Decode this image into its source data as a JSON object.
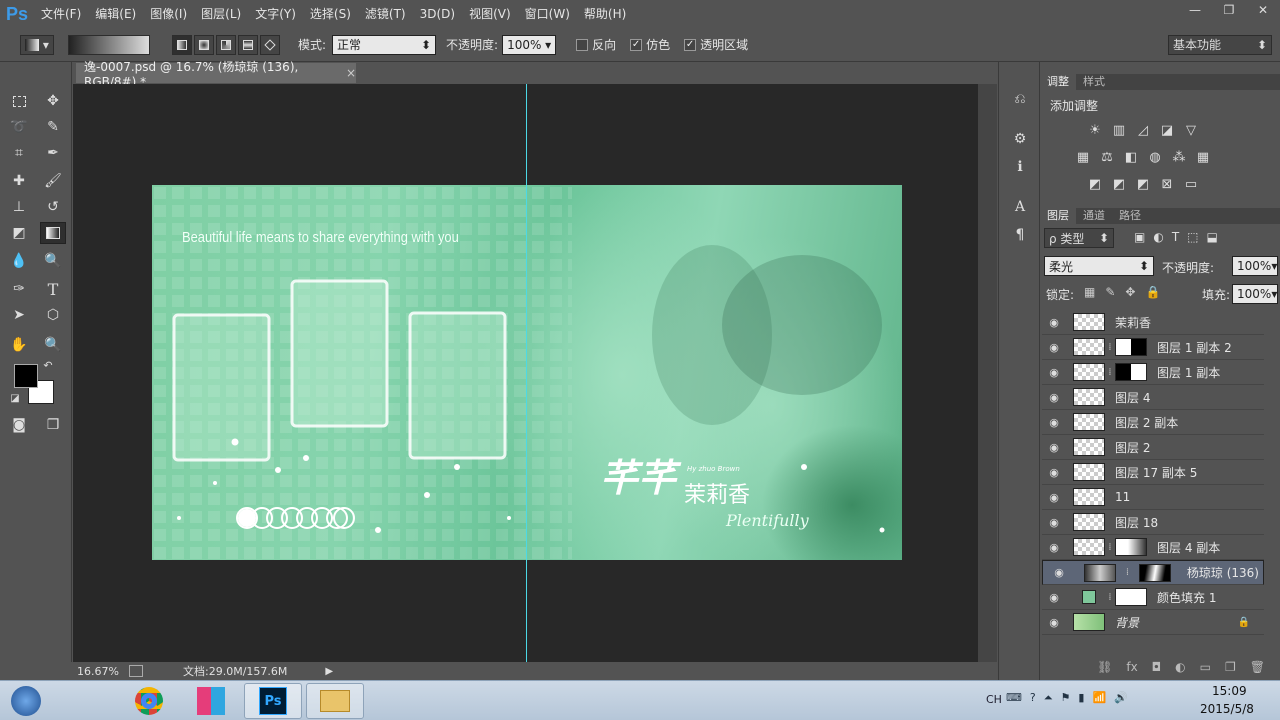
{
  "app": {
    "logo": "Ps",
    "menus": [
      "文件(F)",
      "编辑(E)",
      "图像(I)",
      "图层(L)",
      "文字(Y)",
      "选择(S)",
      "滤镜(T)",
      "3D(D)",
      "视图(V)",
      "窗口(W)",
      "帮助(H)"
    ],
    "window_controls": {
      "minimize": "—",
      "restore": "❐",
      "close": "✕"
    }
  },
  "options": {
    "mode_label": "模式:",
    "mode_value": "正常",
    "opacity_label": "不透明度:",
    "opacity_value": "100%",
    "reverse": "反向",
    "dither": "仿色",
    "transparency": "透明区域",
    "workspace": "基本功能"
  },
  "doc": {
    "tab_title": "逸-0007.psd @ 16.7% (杨琼琼 (136), RGB/8#) *",
    "tab_close": "×",
    "zoom": "16.67%",
    "docsize": "文档:29.0M/157.6M"
  },
  "artwork": {
    "tagline": "Beautiful life means to share everything with you",
    "logo_cn": "芊芊",
    "logo_cn2": "茉莉香",
    "logo_en": "Plentifully",
    "logo_small": "Hy zhuo Brown"
  },
  "adjust": {
    "tab_adjust": "调整",
    "tab_style": "样式",
    "title": "添加调整"
  },
  "layers_panel": {
    "tab_layers": "图层",
    "tab_channels": "通道",
    "tab_paths": "路径",
    "filter": "ρ 类型",
    "blend": "柔光",
    "opacity_label": "不透明度:",
    "opacity_value": "100%",
    "lock_label": "锁定:",
    "fill_label": "填充:",
    "fill_value": "100%",
    "layers": [
      {
        "name": "茉莉香",
        "mask": "none",
        "selected": false
      },
      {
        "name": "图层 1 副本 2",
        "mask": "half-white",
        "selected": false
      },
      {
        "name": "图层 1 副本",
        "mask": "half-black",
        "selected": false
      },
      {
        "name": "图层 4",
        "mask": "none",
        "selected": false
      },
      {
        "name": "图层 2 副本",
        "mask": "none",
        "selected": false
      },
      {
        "name": "图层 2",
        "mask": "none",
        "selected": false
      },
      {
        "name": "图层 17 副本 5",
        "mask": "none",
        "selected": false
      },
      {
        "name": "11",
        "mask": "none",
        "selected": false
      },
      {
        "name": "图层 18",
        "mask": "none",
        "selected": false
      },
      {
        "name": "图层 4 副本",
        "mask": "fade",
        "selected": false
      },
      {
        "name": "杨琼琼 (136)",
        "mask": "fade-dark",
        "selected": true
      },
      {
        "name": "颜色填充 1",
        "mask": "white",
        "selected": false
      },
      {
        "name": "背景",
        "mask": "none",
        "selected": false
      }
    ]
  },
  "taskbar": {
    "ime": "CH",
    "time": "15:09",
    "date": "2015/5/8"
  },
  "colors": {
    "guide": "#4cd9e6",
    "fill_swatch": "#7fc79b"
  }
}
